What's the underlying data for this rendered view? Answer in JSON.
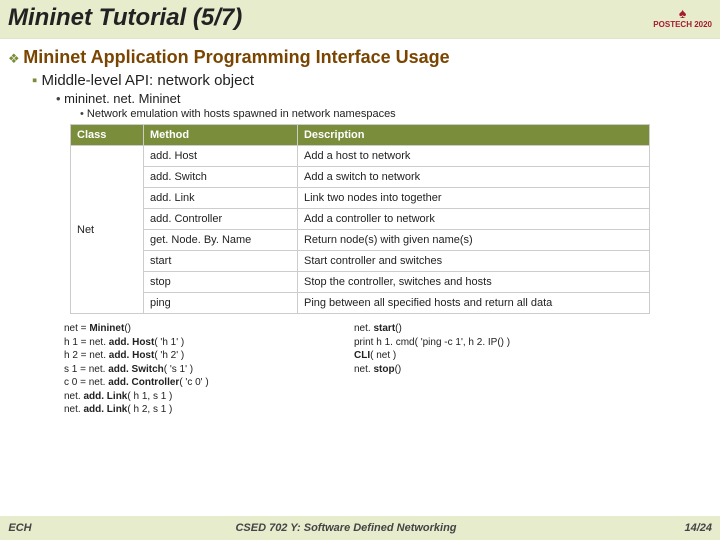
{
  "title": "Mininet Tutorial (5/7)",
  "logo": {
    "brand": "POSTECH",
    "year": "2020"
  },
  "bullets": {
    "lvl1": "Mininet Application Programming Interface Usage",
    "lvl2": "Middle-level API: network object",
    "lvl3": "mininet. net. Mininet",
    "lvl4": "Network emulation with hosts spawned in network namespaces"
  },
  "table": {
    "headers": [
      "Class",
      "Method",
      "Description"
    ],
    "classcell": "Net",
    "rows": [
      {
        "method": "add. Host",
        "desc": "Add a host to network"
      },
      {
        "method": "add. Switch",
        "desc": "Add a switch to network"
      },
      {
        "method": "add. Link",
        "desc": "Link two nodes into together"
      },
      {
        "method": "add. Controller",
        "desc": "Add a controller to network"
      },
      {
        "method": "get. Node. By. Name",
        "desc": "Return node(s) with given name(s)"
      },
      {
        "method": "start",
        "desc": "Start controller and switches"
      },
      {
        "method": "stop",
        "desc": "Stop the controller, switches and hosts"
      },
      {
        "method": "ping",
        "desc": "Ping between all specified hosts and return all data"
      }
    ]
  },
  "code": {
    "left": [
      "net = Mininet()",
      "h 1 = net. add. Host( 'h 1' )",
      "h 2 = net. add. Host( 'h 2' )",
      "s 1 = net. add. Switch( 's 1' )",
      "c 0 = net. add. Controller( 'c 0' )",
      "net. add. Link( h 1, s 1 )",
      "net. add. Link( h 2, s 1 )"
    ],
    "right": [
      "net. start()",
      "print h 1. cmd( 'ping -c 1', h 2. IP() )",
      "CLI( net )",
      "net. stop()"
    ]
  },
  "footer": {
    "left": "ECH",
    "center": "CSED 702 Y: Software Defined Networking",
    "right": "14/24"
  }
}
